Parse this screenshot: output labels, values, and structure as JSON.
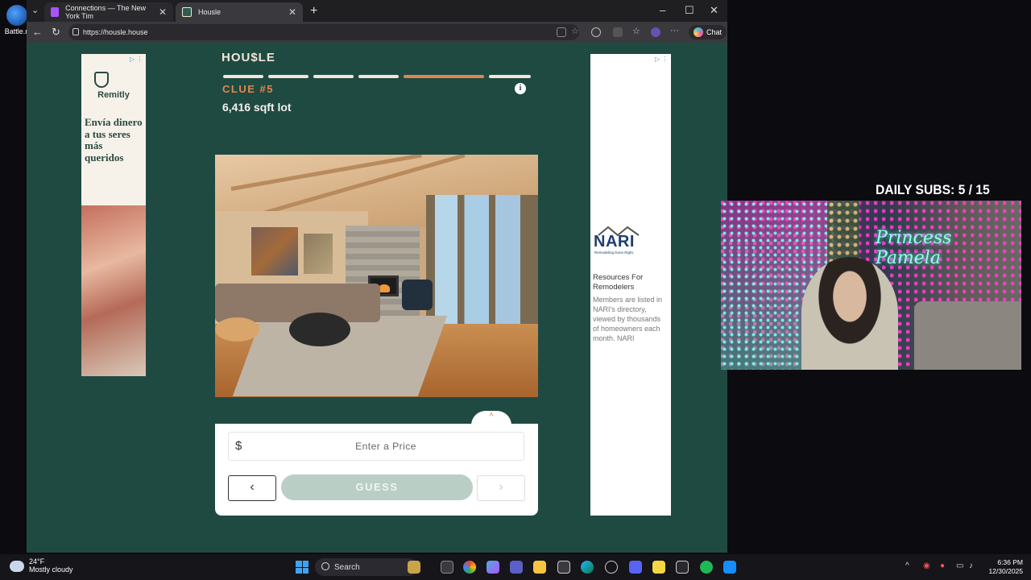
{
  "desktop": {
    "icon_label": "Battle.n"
  },
  "browser": {
    "tabs": [
      {
        "title": "Connections — The New York Tim",
        "color": "#a855f7"
      },
      {
        "title": "Housle",
        "color": "#2f5d50"
      }
    ],
    "url": "https://housle.house",
    "chat_label": "Chat"
  },
  "ads": {
    "left": {
      "brand": "Remitly",
      "copy": "Envía dinero a tus seres más queridos"
    },
    "right": {
      "logo": "NARI",
      "tagline": "Remodeling Done Right.",
      "headline": "Resources For Remodelers",
      "body": "Members are listed in NARI's directory, viewed by thousands of homeowners each month. NARI"
    }
  },
  "game": {
    "logo": "HOU$LE",
    "clue_title": "CLUE #5",
    "clue_text": "6,416 sqft lot",
    "info_icon": "i",
    "progress_active_index": 4,
    "currency": "$",
    "price_placeholder": "Enter a Price",
    "guess_label": "GUESS",
    "prev_label": "‹",
    "next_label": "›",
    "expand_label": "^"
  },
  "overlay": {
    "subs_label": "DAILY SUBS:",
    "subs_count": "5 / 15",
    "neon_sign": "Princess Pamela"
  },
  "taskbar": {
    "temperature": "24°F",
    "condition": "Mostly cloudy",
    "search_label": "Search",
    "time": "6:36 PM",
    "date": "12/30/2025"
  }
}
